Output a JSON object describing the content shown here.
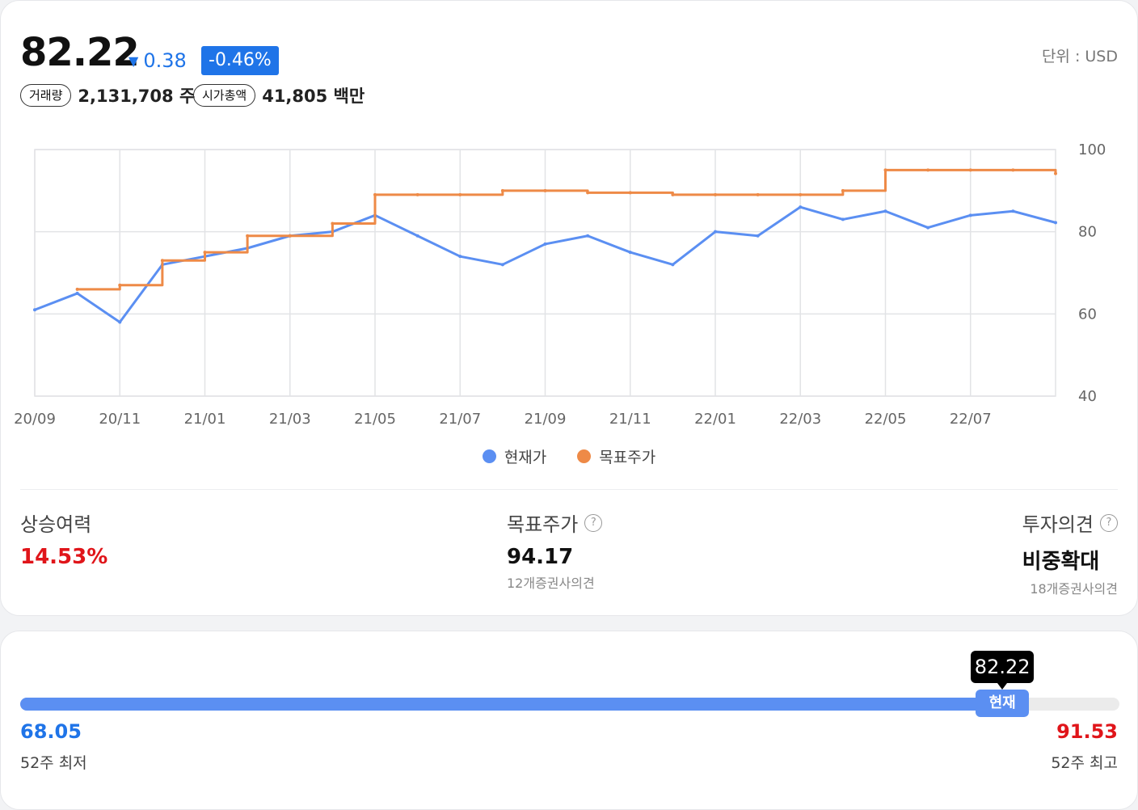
{
  "quote": {
    "price": "82.22",
    "change": "0.38",
    "change_arrow": "▼",
    "change_pct": "-0.46%",
    "unit": "단위 : USD",
    "volume_label": "거래량",
    "volume": "2,131,708 주",
    "market_cap_label": "시가총액",
    "market_cap": "41,805 백만"
  },
  "colors": {
    "accent_blue": "#1f74e8",
    "series_current": "#5b8ff2",
    "series_target": "#ee8a47",
    "up_red": "#e0151a"
  },
  "legend": {
    "current": "현재가",
    "target": "목표주가"
  },
  "chart_data": {
    "type": "line",
    "title": "",
    "xlabel": "",
    "ylabel": "",
    "ylim": [
      40,
      100
    ],
    "yticks": [
      40,
      60,
      80,
      100
    ],
    "x_ticks": [
      "20/09",
      "20/11",
      "21/01",
      "21/03",
      "21/05",
      "21/07",
      "21/09",
      "21/11",
      "22/01",
      "22/03",
      "22/05",
      "22/07"
    ],
    "x": [
      "20/09",
      "20/10",
      "20/11",
      "20/12",
      "21/01",
      "21/02",
      "21/03",
      "21/04",
      "21/05",
      "21/06",
      "21/07",
      "21/08",
      "21/09",
      "21/10",
      "21/11",
      "21/12",
      "22/01",
      "22/02",
      "22/03",
      "22/04",
      "22/05",
      "22/06",
      "22/07",
      "22/08",
      "22/09"
    ],
    "grid": true,
    "series": [
      {
        "name": "현재가",
        "values": [
          61,
          65,
          58,
          72,
          74,
          76,
          79,
          80,
          84,
          79,
          74,
          72,
          77,
          79,
          75,
          72,
          80,
          79,
          86,
          83,
          85,
          81,
          84,
          85,
          82.22
        ]
      },
      {
        "name": "목표주가",
        "values": [
          null,
          66,
          67,
          73,
          75,
          79,
          79,
          82,
          89,
          89,
          89,
          90,
          90,
          89.5,
          89.5,
          89,
          89,
          89,
          89,
          90,
          95,
          95,
          95,
          95,
          94.17
        ]
      }
    ]
  },
  "stats": {
    "upside_label": "상승여력",
    "upside_value": "14.53%",
    "target_label": "목표주가",
    "target_value": "94.17",
    "target_sub": "12개증권사의견",
    "opinion_label": "투자의견",
    "opinion_value": "비중확대",
    "opinion_sub": "18개증권사의견",
    "help_glyph": "?"
  },
  "range": {
    "low": "68.05",
    "high": "91.53",
    "current": "82.22",
    "current_fraction": 0.8935,
    "current_label": "현재",
    "low_label": "52주 최저",
    "high_label": "52주 최고"
  }
}
